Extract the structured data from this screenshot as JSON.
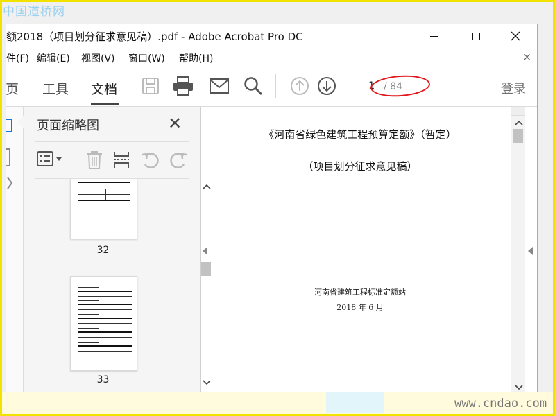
{
  "watermark": {
    "top": "中国道桥网",
    "bottom": "www.cndao.com"
  },
  "window": {
    "title": "额2018（项目划分征求意见稿）.pdf - Adobe Acrobat Pro DC"
  },
  "menubar": {
    "items": [
      {
        "label": "件(F)"
      },
      {
        "label": "编辑(E)"
      },
      {
        "label": "视图(V)"
      },
      {
        "label": "窗口(W)"
      },
      {
        "label": "帮助(H)"
      }
    ],
    "close": "×"
  },
  "toolbar": {
    "tabs": [
      {
        "label": "主页"
      },
      {
        "label": "工具"
      },
      {
        "label": "文档"
      }
    ],
    "page_current": "1",
    "page_total": "/ 84",
    "login": "登录",
    "icons": [
      "save-icon",
      "print-icon",
      "email-icon",
      "search-icon",
      "page-up-icon",
      "page-down-icon"
    ]
  },
  "thumbnails_panel": {
    "title": "页面缩略图",
    "close": "✕",
    "pages": [
      {
        "number": "32"
      },
      {
        "number": "33"
      }
    ]
  },
  "document": {
    "title_line1": "《河南省绿色建筑工程预算定额》（暂定）",
    "title_line2": "（项目划分征求意见稿）",
    "issuer": "河南省建筑工程标准定额站",
    "date": "2018 年 6 月"
  },
  "colors": {
    "highlight_ellipse": "#e2171c",
    "frame": "#f2e200"
  }
}
